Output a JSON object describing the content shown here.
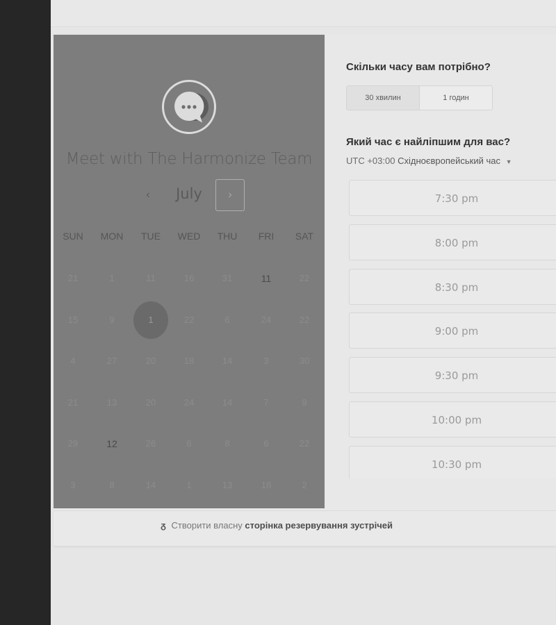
{
  "calendar": {
    "title": "Meet with The Harmonize Team",
    "month": "July",
    "prev_icon": "‹",
    "next_icon": "›",
    "days_of_week": [
      "SUN",
      "MON",
      "TUE",
      "WED",
      "THU",
      "FRI",
      "SAT"
    ],
    "weeks": [
      [
        {
          "label": "21",
          "state": "muted"
        },
        {
          "label": "1",
          "state": "muted"
        },
        {
          "label": "11",
          "state": "muted"
        },
        {
          "label": "16",
          "state": "muted"
        },
        {
          "label": "31",
          "state": "muted"
        },
        {
          "label": "11",
          "state": "available"
        },
        {
          "label": "22",
          "state": "muted"
        }
      ],
      [
        {
          "label": "15",
          "state": "muted"
        },
        {
          "label": "9",
          "state": "muted"
        },
        {
          "label": "1",
          "state": "selected"
        },
        {
          "label": "22",
          "state": "muted"
        },
        {
          "label": "6",
          "state": "muted"
        },
        {
          "label": "24",
          "state": "muted"
        },
        {
          "label": "22",
          "state": "muted"
        }
      ],
      [
        {
          "label": "4",
          "state": "muted"
        },
        {
          "label": "27",
          "state": "muted"
        },
        {
          "label": "20",
          "state": "muted"
        },
        {
          "label": "18",
          "state": "muted"
        },
        {
          "label": "14",
          "state": "muted"
        },
        {
          "label": "3",
          "state": "muted"
        },
        {
          "label": "30",
          "state": "muted"
        }
      ],
      [
        {
          "label": "21",
          "state": "muted"
        },
        {
          "label": "13",
          "state": "muted"
        },
        {
          "label": "20",
          "state": "muted"
        },
        {
          "label": "24",
          "state": "muted"
        },
        {
          "label": "14",
          "state": "muted"
        },
        {
          "label": "7",
          "state": "muted"
        },
        {
          "label": "9",
          "state": "muted"
        }
      ],
      [
        {
          "label": "29",
          "state": "muted"
        },
        {
          "label": "12",
          "state": "available"
        },
        {
          "label": "26",
          "state": "muted"
        },
        {
          "label": "6",
          "state": "muted"
        },
        {
          "label": "8",
          "state": "muted"
        },
        {
          "label": "6",
          "state": "muted"
        },
        {
          "label": "22",
          "state": "muted"
        }
      ],
      [
        {
          "label": "3",
          "state": "muted"
        },
        {
          "label": "8",
          "state": "muted"
        },
        {
          "label": "14",
          "state": "muted"
        },
        {
          "label": "1",
          "state": "muted"
        },
        {
          "label": "13",
          "state": "muted"
        },
        {
          "label": "18",
          "state": "muted"
        },
        {
          "label": "2",
          "state": "muted"
        }
      ]
    ]
  },
  "duration": {
    "question": "Скільки часу вам потрібно?",
    "options": [
      "30 хвилин",
      "1 годин"
    ],
    "selected_index": 0
  },
  "time": {
    "question": "Який час є найліпшим для вас?",
    "timezone_offset": "UTC +03:00",
    "timezone_name": "Східноєвропейський час",
    "slots": [
      "7:30 pm",
      "8:00 pm",
      "8:30 pm",
      "9:00 pm",
      "9:30 pm",
      "10:00 pm",
      "10:30 pm"
    ]
  },
  "footer": {
    "icon": "hubspot-sprocket-icon",
    "prefix": "Створити власну",
    "link": "сторінка резервування зустрічей"
  },
  "colors": {
    "sidebar": "#262626",
    "calendar_panel": "#7d7d7d",
    "background": "#e6e6e6"
  }
}
